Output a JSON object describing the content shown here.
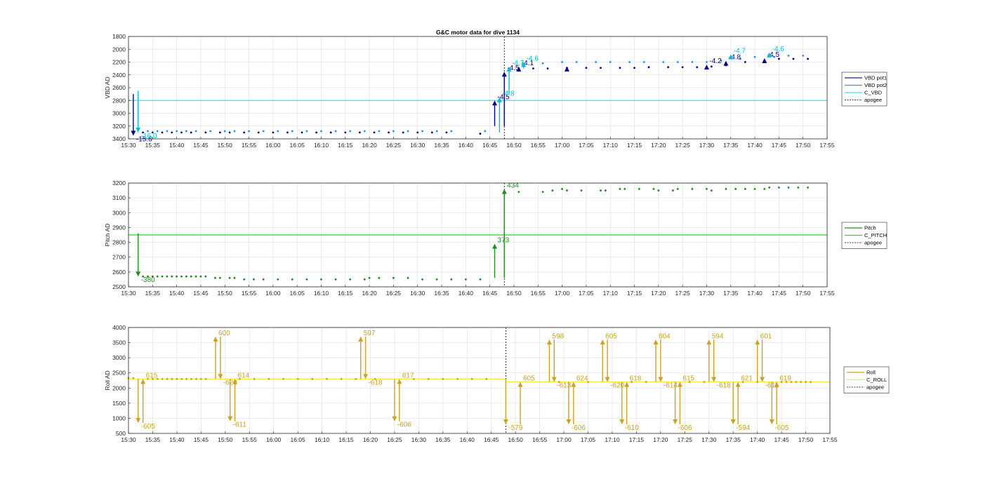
{
  "chart_data": [
    {
      "type": "line",
      "title": "G&C motor data for dive 1134",
      "ylabel": "VBD AD",
      "ylim": [
        1800,
        3400
      ],
      "y_reversed": true,
      "yticks": [
        1800,
        2000,
        2200,
        2400,
        2600,
        2800,
        3000,
        3200,
        3400
      ],
      "xlim": [
        "15:30",
        "17:55"
      ],
      "xticks": [
        "15:30",
        "15:35",
        "15:40",
        "15:45",
        "15:50",
        "15:55",
        "16:00",
        "16:05",
        "16:10",
        "16:15",
        "16:20",
        "16:25",
        "16:30",
        "16:35",
        "16:40",
        "16:45",
        "16:50",
        "16:55",
        "17:00",
        "17:05",
        "17:10",
        "17:15",
        "17:20",
        "17:25",
        "17:30",
        "17:35",
        "17:40",
        "17:45",
        "17:50",
        "17:55"
      ],
      "grid": true,
      "legend": {
        "position": "outside-right",
        "entries": [
          {
            "label": "VBD pot1",
            "color": "#1a237e",
            "style": "solid"
          },
          {
            "label": "VBD pot2",
            "color": "#2196f3",
            "style": "solid"
          },
          {
            "label": "C_VBD",
            "color": "#40e0e8",
            "style": "solid"
          },
          {
            "label": "apogee",
            "color": "#000000",
            "style": "dotted"
          }
        ]
      },
      "reference_lines": [
        {
          "name": "C_VBD",
          "orientation": "horizontal",
          "value": 2800,
          "color": "#40e0e8"
        },
        {
          "name": "apogee",
          "orientation": "vertical",
          "value": "16:48",
          "color": "#000000",
          "style": "dotted"
        }
      ],
      "series": [
        {
          "name": "VBD pot1",
          "color": "#00008b",
          "marker": "dot",
          "x": [
            "15:33",
            "15:35",
            "15:37",
            "15:39",
            "15:41",
            "15:43",
            "15:46",
            "15:49",
            "15:51",
            "15:54",
            "15:57",
            "16:00",
            "16:03",
            "16:06",
            "16:09",
            "16:12",
            "16:15",
            "16:18",
            "16:21",
            "16:24",
            "16:27",
            "16:30",
            "16:33",
            "16:36",
            "16:43",
            "16:51",
            "16:54",
            "16:57",
            "17:01",
            "17:05",
            "17:08",
            "17:12",
            "17:15",
            "17:18",
            "17:22",
            "17:25",
            "17:28",
            "17:31",
            "17:34",
            "17:38",
            "17:42",
            "17:45",
            "17:48",
            "17:51"
          ],
          "y": [
            3300,
            3300,
            3300,
            3300,
            3300,
            3300,
            3300,
            3300,
            3300,
            3300,
            3300,
            3300,
            3300,
            3300,
            3300,
            3300,
            3300,
            3300,
            3300,
            3300,
            3300,
            3300,
            3300,
            3300,
            3320,
            2300,
            2300,
            2300,
            2290,
            2290,
            2290,
            2290,
            2290,
            2280,
            2280,
            2280,
            2280,
            2270,
            2250,
            2200,
            2180,
            2150,
            2150,
            2150
          ]
        },
        {
          "name": "VBD pot2",
          "color": "#1e90ff",
          "marker": "dot",
          "x": [
            "15:34",
            "15:36",
            "15:38",
            "15:40",
            "15:42",
            "15:44",
            "15:47",
            "15:50",
            "15:52",
            "15:55",
            "15:58",
            "16:01",
            "16:04",
            "16:07",
            "16:10",
            "16:13",
            "16:16",
            "16:19",
            "16:22",
            "16:25",
            "16:28",
            "16:31",
            "16:34",
            "16:37",
            "16:44",
            "16:52",
            "16:56",
            "17:00",
            "17:03",
            "17:07",
            "17:10",
            "17:14",
            "17:17",
            "17:21",
            "17:24",
            "17:27",
            "17:30",
            "17:33",
            "17:37",
            "17:40",
            "17:44",
            "17:47",
            "17:50"
          ],
          "y": [
            3280,
            3280,
            3280,
            3280,
            3280,
            3280,
            3280,
            3280,
            3280,
            3280,
            3280,
            3280,
            3280,
            3280,
            3280,
            3280,
            3280,
            3280,
            3280,
            3280,
            3280,
            3280,
            3280,
            3280,
            3280,
            2250,
            2220,
            2200,
            2200,
            2200,
            2200,
            2200,
            2200,
            2200,
            2200,
            2200,
            2200,
            2180,
            2150,
            2120,
            2120,
            2100,
            2100
          ]
        },
        {
          "name": "VBD pump",
          "color": "#00008b",
          "type": "arrows",
          "x": [
            "15:31",
            "16:46",
            "16:48",
            "16:51",
            "17:01",
            "17:30",
            "17:34",
            "17:42"
          ],
          "y0": [
            2700,
            3200,
            3200,
            2350,
            2300,
            2300,
            2250,
            2200
          ],
          "y1": [
            3350,
            2800,
            2350,
            2270,
            2270,
            2240,
            2180,
            2140
          ],
          "labels": [
            "-15.6",
            "-4.5",
            "-4.5",
            "-4.1",
            "",
            "-4.2",
            "-4.8",
            "-4.5"
          ]
        },
        {
          "name": "VBD pump 2",
          "color": "#00bcd4",
          "type": "arrows",
          "x": [
            "15:32",
            "16:47",
            "16:49",
            "16:52",
            "17:35",
            "17:43"
          ],
          "y0": [
            2650,
            3300,
            2700,
            2300,
            2150,
            2100
          ],
          "y1": [
            3300,
            2750,
            2270,
            2200,
            2080,
            2050
          ],
          "labels": [
            "-16.0",
            "-4.8",
            "-4.7",
            "-4.6",
            "-4.7",
            "-4.6"
          ]
        }
      ]
    },
    {
      "type": "line",
      "ylabel": "Pitch AD",
      "ylim": [
        2500,
        3200
      ],
      "yticks": [
        2500,
        2600,
        2700,
        2800,
        2900,
        3000,
        3100,
        3200
      ],
      "xlim": [
        "15:30",
        "17:55"
      ],
      "xticks": [
        "15:30",
        "15:35",
        "15:40",
        "15:45",
        "15:50",
        "15:55",
        "16:00",
        "16:05",
        "16:10",
        "16:15",
        "16:20",
        "16:25",
        "16:30",
        "16:35",
        "16:40",
        "16:45",
        "16:50",
        "16:55",
        "17:00",
        "17:05",
        "17:10",
        "17:15",
        "17:20",
        "17:25",
        "17:30",
        "17:35",
        "17:40",
        "17:45",
        "17:50",
        "17:55"
      ],
      "grid": true,
      "legend": {
        "position": "outside-right",
        "entries": [
          {
            "label": "Pitch",
            "color": "#228b22",
            "style": "solid"
          },
          {
            "label": "C_PITCH",
            "color": "#32cd32",
            "style": "solid"
          },
          {
            "label": "apogee",
            "color": "#000000",
            "style": "dotted"
          }
        ]
      },
      "reference_lines": [
        {
          "name": "C_PITCH",
          "orientation": "horizontal",
          "value": 2850,
          "color": "#32cd32"
        },
        {
          "name": "apogee",
          "orientation": "vertical",
          "value": "16:48",
          "color": "#000000",
          "style": "dotted"
        }
      ],
      "series": [
        {
          "name": "Pitch",
          "color": "#228b22",
          "marker": "dot",
          "x": [
            "15:33",
            "15:34",
            "15:35",
            "15:36",
            "15:37",
            "15:38",
            "15:39",
            "15:40",
            "15:41",
            "15:42",
            "15:43",
            "15:44",
            "15:45",
            "15:46",
            "15:48",
            "15:49",
            "15:51",
            "15:52",
            "15:54",
            "15:56",
            "15:58",
            "16:01",
            "16:04",
            "16:07",
            "16:10",
            "16:13",
            "16:16",
            "16:19",
            "16:20",
            "16:22",
            "16:25",
            "16:28",
            "16:31",
            "16:34",
            "16:37",
            "16:40",
            "16:43",
            "16:51",
            "16:56",
            "16:58",
            "17:00",
            "17:01",
            "17:04",
            "17:08",
            "17:09",
            "17:12",
            "17:13",
            "17:16",
            "17:19",
            "17:20",
            "17:23",
            "17:24",
            "17:27",
            "17:30",
            "17:31",
            "17:34",
            "17:36",
            "17:38",
            "17:40",
            "17:42",
            "17:43",
            "17:45",
            "17:47",
            "17:49",
            "17:51"
          ],
          "y": [
            2570,
            2570,
            2570,
            2570,
            2570,
            2570,
            2570,
            2570,
            2570,
            2570,
            2570,
            2570,
            2570,
            2570,
            2560,
            2560,
            2560,
            2560,
            2550,
            2550,
            2550,
            2550,
            2550,
            2550,
            2550,
            2550,
            2550,
            2550,
            2560,
            2560,
            2560,
            2560,
            2550,
            2550,
            2550,
            2550,
            2550,
            3140,
            3140,
            3150,
            3160,
            3150,
            3150,
            3150,
            3150,
            3160,
            3160,
            3160,
            3160,
            3150,
            3150,
            3160,
            3160,
            3160,
            3150,
            3160,
            3160,
            3160,
            3160,
            3160,
            3170,
            3170,
            3170,
            3170,
            3170
          ]
        },
        {
          "name": "Pitch moves",
          "color": "#228b22",
          "type": "arrows",
          "x": [
            "15:32",
            "16:46",
            "16:48"
          ],
          "y0": [
            2860,
            2560,
            2560
          ],
          "y1": [
            2570,
            2790,
            3160
          ],
          "labels": [
            "-380",
            "373",
            "434"
          ]
        }
      ]
    },
    {
      "type": "line",
      "ylabel": "Roll AD",
      "ylim": [
        500,
        4000
      ],
      "yticks": [
        500,
        1000,
        1500,
        2000,
        2500,
        3000,
        3500,
        4000
      ],
      "xlim": [
        "15:30",
        "17:55"
      ],
      "xticks": [
        "15:30",
        "15:35",
        "15:40",
        "15:45",
        "15:50",
        "15:55",
        "16:00",
        "16:05",
        "16:10",
        "16:15",
        "16:20",
        "16:25",
        "16:30",
        "16:35",
        "16:40",
        "16:45",
        "16:50",
        "16:55",
        "17:00",
        "17:05",
        "17:10",
        "17:15",
        "17:20",
        "17:25",
        "17:30",
        "17:35",
        "17:40",
        "17:45",
        "17:50",
        "17:55"
      ],
      "grid": true,
      "legend": {
        "position": "outside-right",
        "entries": [
          {
            "label": "Roll",
            "color": "#d4a017",
            "style": "solid"
          },
          {
            "label": "C_ROLL",
            "color": "#ffeb3b",
            "style": "solid"
          },
          {
            "label": "apogee",
            "color": "#000000",
            "style": "dotted"
          }
        ]
      },
      "reference_lines": [
        {
          "name": "C_ROLL",
          "orientation": "horizontal",
          "value": 2300,
          "x_to": "16:48",
          "color": "#f5e642"
        },
        {
          "name": "C_ROLL",
          "orientation": "horizontal",
          "value": 2200,
          "x_from": "16:48",
          "color": "#f5e642"
        },
        {
          "name": "apogee",
          "orientation": "vertical",
          "value": "16:48",
          "color": "#000000",
          "style": "dotted"
        }
      ],
      "series": [
        {
          "name": "Roll",
          "color": "#c9a227",
          "marker": "dot",
          "x": [
            "15:30",
            "15:31",
            "15:34",
            "15:35",
            "15:36",
            "15:37",
            "15:38",
            "15:39",
            "15:40",
            "15:41",
            "15:42",
            "15:43",
            "15:44",
            "15:45",
            "15:46",
            "15:53",
            "15:56",
            "15:59",
            "16:02",
            "16:05",
            "16:08",
            "16:11",
            "16:14",
            "16:17",
            "16:21",
            "16:29",
            "16:32",
            "16:35",
            "16:38",
            "16:41",
            "16:44",
            "16:59",
            "17:05",
            "17:14",
            "17:17",
            "17:26",
            "17:29",
            "17:37",
            "17:40",
            "17:45",
            "17:46",
            "17:47",
            "17:48",
            "17:49",
            "17:50",
            "17:51"
          ],
          "y": [
            2330,
            2330,
            2300,
            2300,
            2300,
            2300,
            2300,
            2300,
            2300,
            2300,
            2300,
            2300,
            2300,
            2300,
            2300,
            2300,
            2300,
            2300,
            2300,
            2300,
            2300,
            2300,
            2300,
            2300,
            2300,
            2300,
            2300,
            2300,
            2300,
            2300,
            2300,
            2200,
            2200,
            2200,
            2200,
            2200,
            2200,
            2200,
            2200,
            2200,
            2200,
            2200,
            2200,
            2200,
            2200,
            2200
          ]
        },
        {
          "name": "Roll moves",
          "color": "#c9a227",
          "type": "arrows",
          "x": [
            "15:32",
            "15:33",
            "15:48",
            "15:49",
            "15:51",
            "15:52",
            "16:18",
            "16:19",
            "16:25",
            "16:26",
            "16:48",
            "16:51",
            "16:57",
            "16:58",
            "17:01",
            "17:02",
            "17:08",
            "17:09",
            "17:12",
            "17:13",
            "17:19",
            "17:20",
            "17:23",
            "17:24",
            "17:30",
            "17:31",
            "17:35",
            "17:36",
            "17:40",
            "17:41",
            "17:43",
            "17:44"
          ],
          "y0": [
            2300,
            850,
            2300,
            3700,
            2300,
            900,
            2300,
            3700,
            2300,
            900,
            2300,
            800,
            2200,
            3600,
            2200,
            800,
            2200,
            3600,
            2200,
            800,
            2200,
            3600,
            2200,
            800,
            2200,
            3600,
            2200,
            800,
            2200,
            3600,
            2200,
            800
          ],
          "y1": [
            850,
            2300,
            3700,
            2300,
            900,
            2300,
            3700,
            2300,
            900,
            2300,
            800,
            2200,
            3600,
            2200,
            800,
            2200,
            3600,
            2200,
            800,
            2200,
            3600,
            2200,
            800,
            2200,
            3600,
            2200,
            800,
            2200,
            3600,
            2200,
            800,
            2200
          ],
          "labels": [
            "-605",
            "615",
            "600",
            "-623",
            "-611",
            "614",
            "597",
            "-618",
            "-606",
            "617",
            "-579",
            "605",
            "598",
            "-613",
            "-606",
            "624",
            "605",
            "-620",
            "-610",
            "618",
            "604",
            "-614",
            "-606",
            "615",
            "594",
            "-618",
            "-594",
            "621",
            "601",
            "-611",
            "-605",
            "619"
          ]
        }
      ]
    }
  ]
}
